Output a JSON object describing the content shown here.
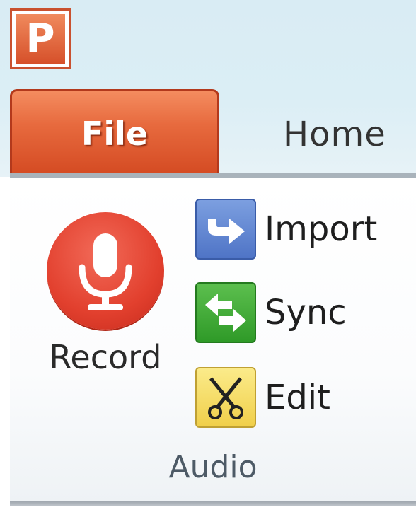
{
  "app": {
    "icon_letter": "P",
    "icon_name": "powerpoint-icon"
  },
  "tabs": {
    "file": "File",
    "home": "Home"
  },
  "audio_group": {
    "record_label": "Record",
    "import_label": "Import",
    "sync_label": "Sync",
    "edit_label": "Edit",
    "group_label": "Audio"
  },
  "colors": {
    "file_tab": "#e2572e",
    "record": "#e2402e",
    "import": "#5b7fd0",
    "sync": "#3aa832",
    "edit": "#f2d75a"
  },
  "icons": {
    "record": "microphone-icon",
    "import": "arrow-import-icon",
    "sync": "sync-arrows-icon",
    "edit": "scissors-icon"
  }
}
